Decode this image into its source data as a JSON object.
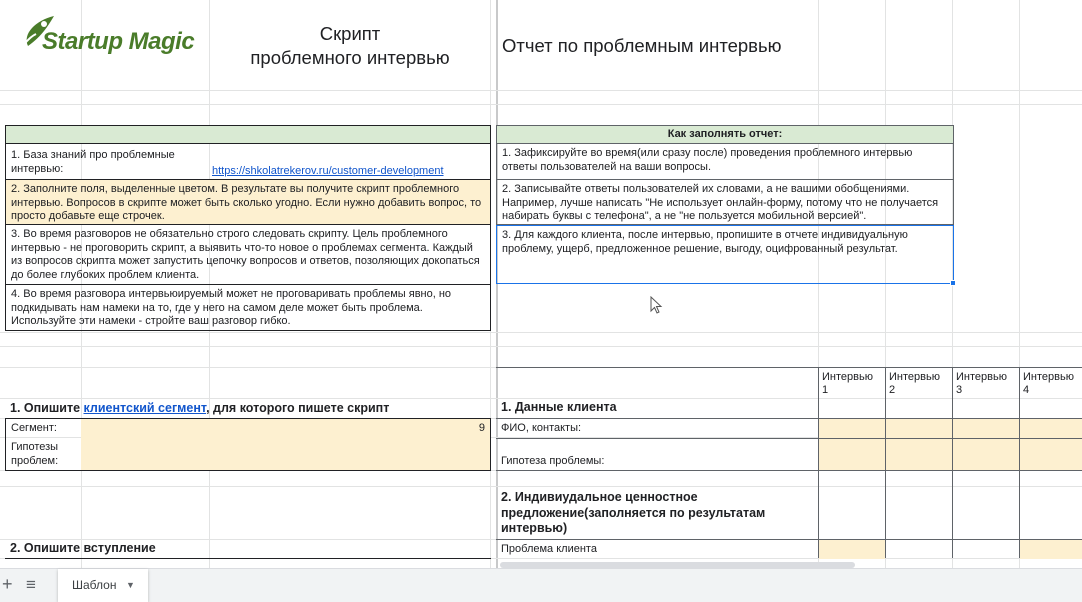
{
  "logo": {
    "text": "Startup Magic"
  },
  "left": {
    "title_line1": "Скрипт",
    "title_line2": "проблемного интервью",
    "rows": [
      {
        "text": "1. База знаний про проблемные интервью:",
        "link": "https://shkolatrekerov.ru/customer-development"
      },
      {
        "text": "2. Заполните поля, выделенные цветом. В результате вы получите скрипт проблемного интервью. Вопросов в скрипте может быть сколько угодно. Если нужно добавить вопрос, то просто добавьте еще строчек."
      },
      {
        "text": "3. Во время разговоров не обязательно строго следовать скрипту. Цель проблемного интервью - не проговорить скрипт, а выявить что-то новое о проблемах сегмента. Каждый из вопросов скрипта может запустить цепочку вопросов и ответов, позоляющих докопаться до более глубоких проблем клиента."
      },
      {
        "text": "4. Во время разговора интервьюируемый может не проговаривать проблемы явно, но подкидывать нам намеки на то, где у него на самом деле может быть проблема. Используйте эти намеки - стройте ваш разговор гибко."
      }
    ],
    "section1": {
      "prefix": "1. Опишите ",
      "link": "клиентский сегмент",
      "suffix": ", для которого пишете скрипт"
    },
    "segment_label": "Сегмент:",
    "segment_value": "9",
    "hypotheses_label": "Гипотезы проблем:",
    "section2": "2. Опишите вступление"
  },
  "right": {
    "title": "Отчет по проблемным интервью",
    "how_to_header": "Как заполнять отчет:",
    "how_to": [
      "1. Зафиксируйте во время(или сразу после) проведения проблемного интервью ответы пользователей на ваши вопросы.",
      "2. Записывайте ответы пользователей их словами, а не вашими обобщениями. Например, лучше написать \"Не использует онлайн-форму, потому что не получается набирать буквы с телефона\", а не \"не пользуется мобильной версией\".",
      "3. Для каждого клиента, после интервью, пропишите в отчете индивидуальную проблему, ущерб, предложенное решение, выгоду, оцифрованный результат."
    ],
    "interviews": [
      "Интервью 1",
      "Интервью 2",
      "Интервью 3",
      "Интервью 4"
    ],
    "section1": "1. Данные клиента",
    "fio_label": "ФИО, контакты:",
    "hypothesis_label": "Гипотеза проблемы:",
    "section2": "2. Индивиудальное ценностное предложение(заполняется по результатам интервью)",
    "problem_label": "Проблема клиента"
  },
  "tabs": {
    "add": "+",
    "menu": "≡",
    "sheet": "Шаблон"
  },
  "colors": {
    "tan": "#fdf0d0",
    "green": "#d9ead3",
    "link": "#1155cc",
    "logo_green": "#4a7c2a"
  }
}
